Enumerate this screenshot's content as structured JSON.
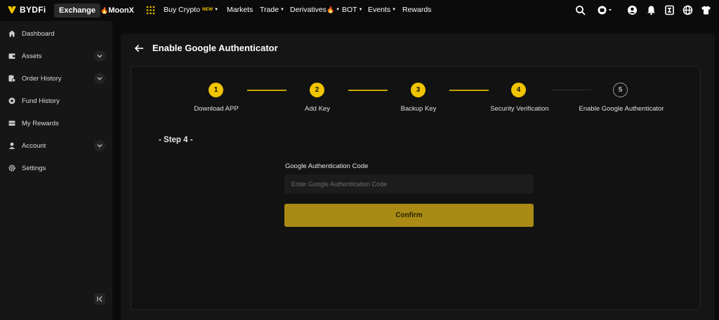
{
  "brand": {
    "name": "BYDFi"
  },
  "topnav": {
    "exchange_label": "Exchange",
    "moonx_label": "MoonX",
    "items": [
      {
        "label": "Buy Crypto",
        "badge": "NEW",
        "caret": true
      },
      {
        "label": "Markets"
      },
      {
        "label": "Trade",
        "caret": true
      },
      {
        "label": "Derivatives",
        "flame": true,
        "caret": true
      },
      {
        "label": "BOT",
        "caret": true
      },
      {
        "label": "Events",
        "caret": true
      },
      {
        "label": "Rewards"
      }
    ],
    "icons": [
      "search-icon",
      "wallet-icon",
      "user-icon",
      "bell-icon",
      "download-icon",
      "globe-icon",
      "shirt-icon"
    ]
  },
  "sidebar": {
    "items": [
      {
        "label": "Dashboard",
        "icon": "home-icon",
        "expandable": false
      },
      {
        "label": "Assets",
        "icon": "wallet-icon",
        "expandable": true
      },
      {
        "label": "Order History",
        "icon": "order-icon",
        "expandable": true
      },
      {
        "label": "Fund History",
        "icon": "fund-icon",
        "expandable": false
      },
      {
        "label": "My Rewards",
        "icon": "rewards-icon",
        "expandable": false
      },
      {
        "label": "Account",
        "icon": "account-icon",
        "expandable": true
      },
      {
        "label": "Settings",
        "icon": "gear-icon",
        "expandable": false
      }
    ]
  },
  "page": {
    "title": "Enable Google Authenticator",
    "steps": [
      {
        "number": "1",
        "label": "Download APP",
        "done": true
      },
      {
        "number": "2",
        "label": "Add Key",
        "done": true
      },
      {
        "number": "3",
        "label": "Backup Key",
        "done": true
      },
      {
        "number": "4",
        "label": "Security Verification",
        "done": true
      },
      {
        "number": "5",
        "label": "Enable Google Authenticator",
        "done": false
      }
    ],
    "current_step_heading": "- Step 4 -",
    "code_field": {
      "label": "Google Authentication Code",
      "placeholder": "Enter Google Authentication Code",
      "value": ""
    },
    "confirm_label": "Confirm"
  },
  "colors": {
    "accent": "#f0c400",
    "confirm_bg": "#a88a14",
    "background": "#0b0b0b",
    "sidebar_bg": "#161616"
  }
}
